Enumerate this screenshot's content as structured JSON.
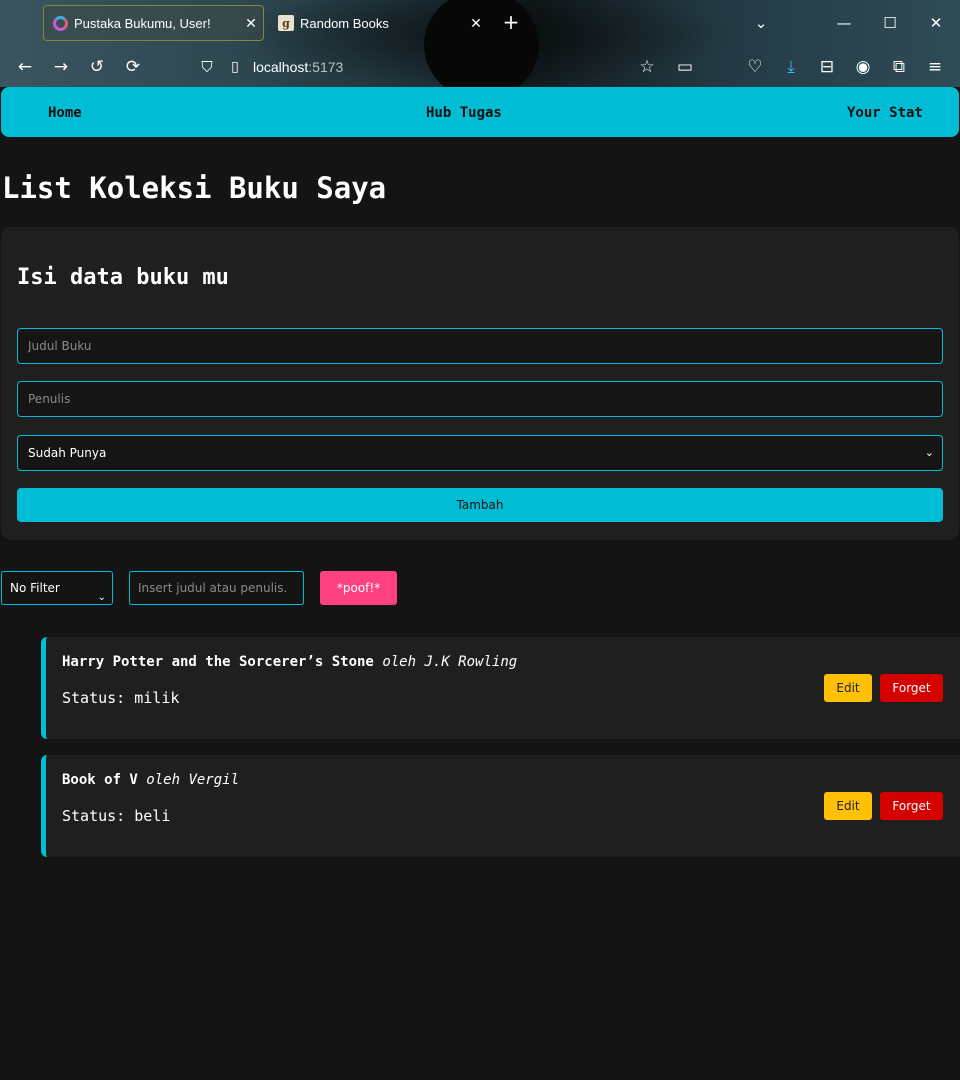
{
  "browser": {
    "tabs": [
      {
        "title": "Pustaka Bukumu, User!",
        "favicon": "ring-logo-icon",
        "active": true
      },
      {
        "title": "Random Books",
        "favicon": "goodreads-g-icon",
        "active": false
      }
    ],
    "url_host": "localhost",
    "url_port": ":5173"
  },
  "nav": {
    "home": "Home",
    "hub": "Hub Tugas",
    "stat": "Your Stat"
  },
  "page_title": "List Koleksi Buku Saya",
  "form": {
    "heading": "Isi data buku mu",
    "title_placeholder": "Judul Buku",
    "author_placeholder": "Penulis",
    "status_selected": "Sudah Punya",
    "submit_label": "Tambah"
  },
  "filter": {
    "selected": "No Filter",
    "search_placeholder": "Insert judul atau penulis.",
    "poof_label": "*poof!*"
  },
  "books": [
    {
      "title": "Harry Potter and the Sorcerer’s Stone",
      "author": "oleh J.K Rowling",
      "status": "Status: milik"
    },
    {
      "title": "Book of V",
      "author": "oleh Vergil",
      "status": "Status: beli"
    }
  ],
  "book_actions": {
    "edit": "Edit",
    "forget": "Forget"
  },
  "colors": {
    "accent": "#00bcd4",
    "poof": "#ff4081",
    "edit": "#ffc107",
    "forget": "#d50000",
    "background": "#141414",
    "card": "#1f1f1f"
  }
}
